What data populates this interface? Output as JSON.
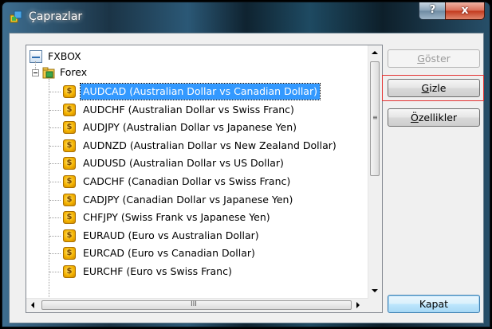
{
  "window": {
    "title": "Çaprazlar",
    "help_glyph": "?",
    "close_glyph": "x"
  },
  "tree": {
    "root": {
      "label": "FXBOX",
      "icon": "fxbox-icon"
    },
    "group": {
      "label": "Forex",
      "icon": "forex-folder-icon",
      "expander": "minus"
    },
    "items": [
      {
        "label": "AUDCAD  (Australian Dollar vs Canadian Dollar)",
        "selected": true
      },
      {
        "label": "AUDCHF  (Australian Dollar vs Swiss Franc)",
        "selected": false
      },
      {
        "label": "AUDJPY  (Australian Dollar vs Japanese Yen)",
        "selected": false
      },
      {
        "label": "AUDNZD  (Australian Dollar vs New Zealand Dollar)",
        "selected": false
      },
      {
        "label": "AUDUSD  (Australian Dollar vs US Dollar)",
        "selected": false
      },
      {
        "label": "CADCHF  (Canadian Dollar vs Swiss Franc)",
        "selected": false
      },
      {
        "label": "CADJPY  (Canadian Dollar vs Japanese Yen)",
        "selected": false
      },
      {
        "label": "CHFJPY  (Swiss Frank vs Japanese Yen)",
        "selected": false
      },
      {
        "label": "EURAUD  (Euro vs Australian Dollar)",
        "selected": false
      },
      {
        "label": "EURCAD  (Euro vs Canadian Dollar)",
        "selected": false
      },
      {
        "label": "EURCHF  (Euro vs Swiss Franc)",
        "selected": false
      }
    ],
    "item_icon_glyph": "$",
    "hscroll_grip": "III"
  },
  "buttons": {
    "show": {
      "label_pre": "",
      "label_u": "G",
      "label_post": "öster",
      "enabled": false
    },
    "hide": {
      "label_pre": "",
      "label_u": "G",
      "label_post": "izle",
      "enabled": true
    },
    "properties": {
      "label_pre": "",
      "label_u": "Ö",
      "label_post": "zellikler",
      "enabled": true
    },
    "close": {
      "label": "Kapat"
    }
  },
  "colors": {
    "selection": "#3399ff",
    "highlight_border": "#e33333",
    "close_button": "#c23b1f"
  }
}
